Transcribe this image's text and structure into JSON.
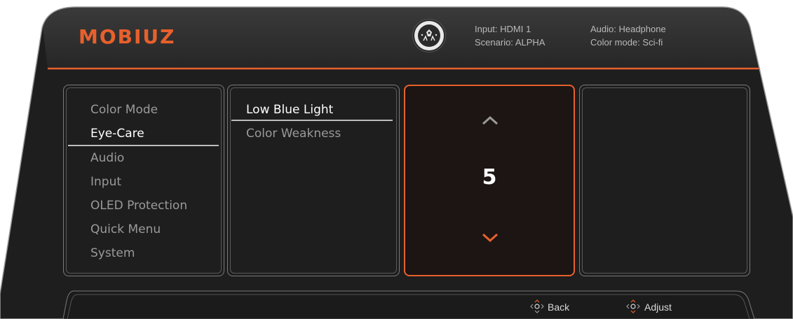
{
  "brand": {
    "logo_text": "MOBIUZ"
  },
  "status": {
    "input": "Input: HDMI 1",
    "scenario": "Scenario: ALPHA",
    "audio": "Audio: Headphone",
    "color_mode": "Color mode: Sci-fi"
  },
  "main_menu": {
    "items": [
      {
        "label": "Color Mode",
        "selected": false
      },
      {
        "label": "Eye-Care",
        "selected": true
      },
      {
        "label": "Audio",
        "selected": false
      },
      {
        "label": "Input",
        "selected": false
      },
      {
        "label": "OLED Protection",
        "selected": false
      },
      {
        "label": "Quick Menu",
        "selected": false
      },
      {
        "label": "System",
        "selected": false
      }
    ]
  },
  "sub_menu": {
    "items": [
      {
        "label": "Low Blue Light",
        "selected": true
      },
      {
        "label": "Color Weakness",
        "selected": false
      }
    ]
  },
  "value_panel": {
    "value": "5"
  },
  "footer": {
    "back_label": "Back",
    "adjust_label": "Adjust"
  },
  "colors": {
    "accent": "#e8602c",
    "bezel": "#1f1f1f",
    "header": "#2e2e2e"
  },
  "icons": [
    "brand-emblem-icon",
    "chevron-up-icon",
    "chevron-down-icon",
    "joystick-icon"
  ]
}
